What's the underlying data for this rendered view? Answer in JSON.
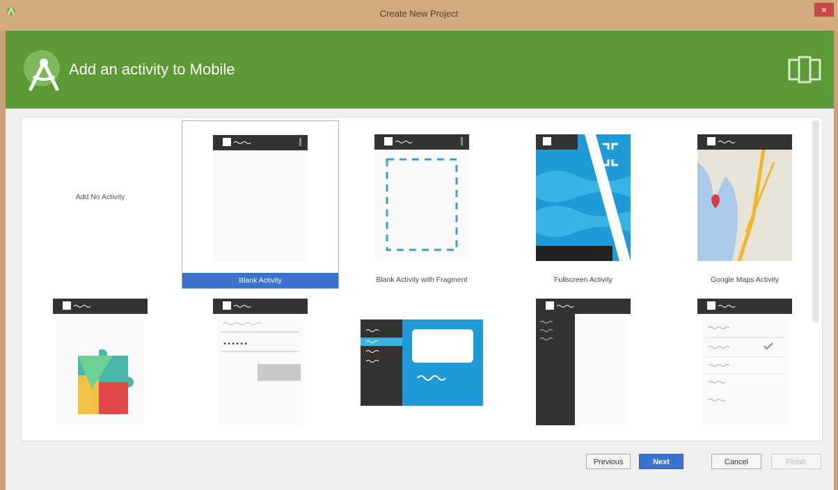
{
  "window": {
    "title": "Create New Project",
    "close_glyph": "×"
  },
  "banner": {
    "heading": "Add an activity to Mobile",
    "color": "#5b9a34"
  },
  "gallery": {
    "no_activity_label": "Add No Activity",
    "row1": [
      {
        "label": "Blank Activity",
        "selected": true
      },
      {
        "label": "Blank Activity with Fragment"
      },
      {
        "label": "Fullscreen Activity"
      },
      {
        "label": "Google Maps Activity"
      }
    ]
  },
  "buttons": {
    "previous": "Previous",
    "next": "Next",
    "cancel": "Cancel",
    "finish": "Finish"
  },
  "colors": {
    "accent": "#3a72cc",
    "titlebar": "#d2aa80",
    "close": "#c74a4a"
  }
}
